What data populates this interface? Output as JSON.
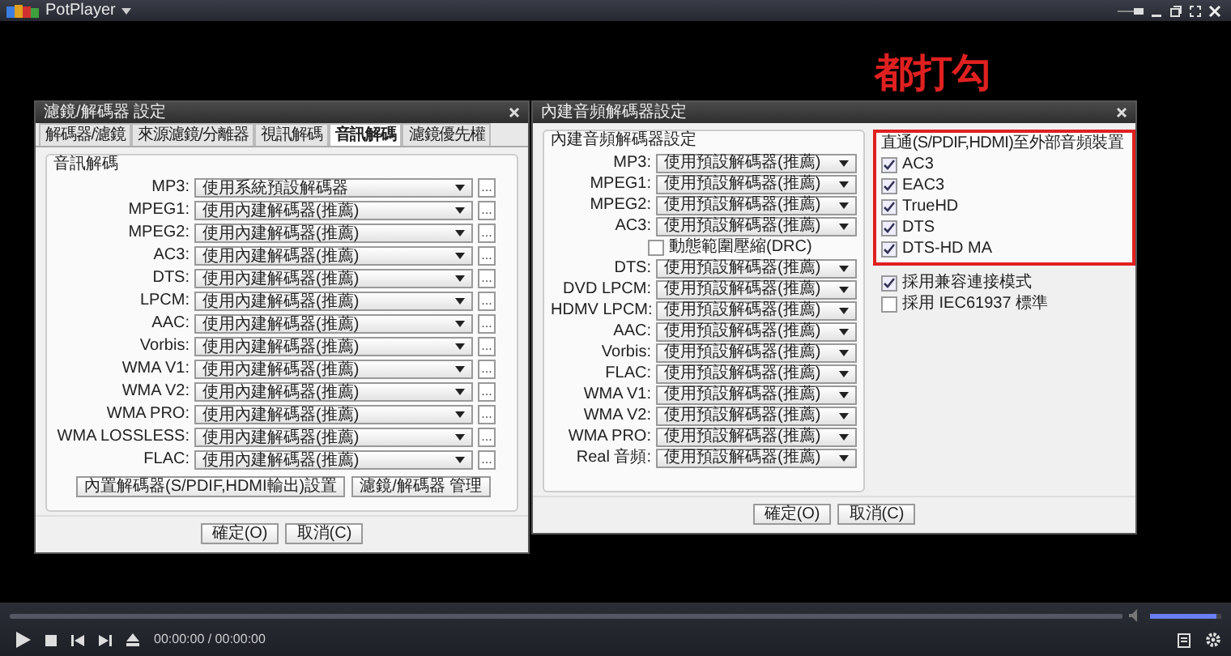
{
  "player": {
    "title": "PotPlayer",
    "time": "00:00:00 / 00:00:00",
    "volume": {
      "level": 0.93
    }
  },
  "filter_dialog": {
    "title": "濾鏡/解碼器 設定",
    "tabs": [
      {
        "label": "解碼器/濾鏡",
        "selected": false
      },
      {
        "label": "來源濾鏡/分離器",
        "selected": false
      },
      {
        "label": "視訊解碼",
        "selected": false
      },
      {
        "label": "音訊解碼",
        "selected": true
      },
      {
        "label": "濾鏡優先權",
        "selected": false
      }
    ],
    "group_title": "音訊解碼",
    "rows": [
      {
        "label": "MP3:",
        "value": "使用系統預設解碼器",
        "button": "..."
      },
      {
        "label": "MPEG1:",
        "value": "使用內建解碼器(推薦)",
        "button": "..."
      },
      {
        "label": "MPEG2:",
        "value": "使用內建解碼器(推薦)",
        "button": "..."
      },
      {
        "label": "AC3:",
        "value": "使用內建解碼器(推薦)",
        "button": "..."
      },
      {
        "label": "DTS:",
        "value": "使用內建解碼器(推薦)",
        "button": "..."
      },
      {
        "label": "LPCM:",
        "value": "使用內建解碼器(推薦)",
        "button": "..."
      },
      {
        "label": "AAC:",
        "value": "使用內建解碼器(推薦)",
        "button": "..."
      },
      {
        "label": "Vorbis:",
        "value": "使用內建解碼器(推薦)",
        "button": "..."
      },
      {
        "label": "WMA V1:",
        "value": "使用內建解碼器(推薦)",
        "button": "..."
      },
      {
        "label": "WMA V2:",
        "value": "使用內建解碼器(推薦)",
        "button": "..."
      },
      {
        "label": "WMA PRO:",
        "value": "使用內建解碼器(推薦)",
        "button": "..."
      },
      {
        "label": "WMA LOSSLESS:",
        "value": "使用內建解碼器(推薦)",
        "button": "..."
      },
      {
        "label": "FLAC:",
        "value": "使用內建解碼器(推薦)",
        "button": "..."
      }
    ],
    "buttons": [
      "內置解碼器(S/PDIF,HDMI輸出)設置",
      "濾鏡/解碼器 管理"
    ],
    "footer_buttons": [
      "確定(O)",
      "取消(C)"
    ]
  },
  "audio_dialog": {
    "title": "內建音頻解碼器設定",
    "group_title": "內建音頻解碼器設定",
    "rows": [
      {
        "kind": "select",
        "label": "MP3:",
        "value": "使用預設解碼器(推薦)"
      },
      {
        "kind": "select",
        "label": "MPEG1:",
        "value": "使用預設解碼器(推薦)"
      },
      {
        "kind": "select",
        "label": "MPEG2:",
        "value": "使用預設解碼器(推薦)"
      },
      {
        "kind": "select",
        "label": "AC3:",
        "value": "使用預設解碼器(推薦)"
      },
      {
        "kind": "checkbox",
        "label": "動態範圍壓縮(DRC)",
        "checked": false
      },
      {
        "kind": "select",
        "label": "DTS:",
        "value": "使用預設解碼器(推薦)"
      },
      {
        "kind": "select",
        "label": "DVD LPCM:",
        "value": "使用預設解碼器(推薦)"
      },
      {
        "kind": "select",
        "label": "HDMV LPCM:",
        "value": "使用預設解碼器(推薦)"
      },
      {
        "kind": "select",
        "label": "AAC:",
        "value": "使用預設解碼器(推薦)"
      },
      {
        "kind": "select",
        "label": "Vorbis:",
        "value": "使用預設解碼器(推薦)"
      },
      {
        "kind": "select",
        "label": "FLAC:",
        "value": "使用預設解碼器(推薦)"
      },
      {
        "kind": "select",
        "label": "WMA V1:",
        "value": "使用預設解碼器(推薦)"
      },
      {
        "kind": "select",
        "label": "WMA V2:",
        "value": "使用預設解碼器(推薦)"
      },
      {
        "kind": "select",
        "label": "WMA PRO:",
        "value": "使用預設解碼器(推薦)"
      },
      {
        "kind": "select",
        "label": "Real 音頻:",
        "value": "使用預設解碼器(推薦)"
      }
    ],
    "passthrough": {
      "title": "直通(S/PDIF,HDMI)至外部音頻裝置",
      "options": [
        {
          "label": "AC3",
          "checked": true
        },
        {
          "label": "EAC3",
          "checked": true
        },
        {
          "label": "TrueHD",
          "checked": true
        },
        {
          "label": "DTS",
          "checked": true
        },
        {
          "label": "DTS-HD MA",
          "checked": true
        }
      ]
    },
    "options": [
      {
        "label": "採用兼容連接模式",
        "checked": true
      },
      {
        "label": "採用 IEC61937 標準",
        "checked": false
      }
    ],
    "footer_buttons": [
      "確定(O)",
      "取消(C)"
    ]
  },
  "annotation": {
    "text": "都打勾"
  }
}
